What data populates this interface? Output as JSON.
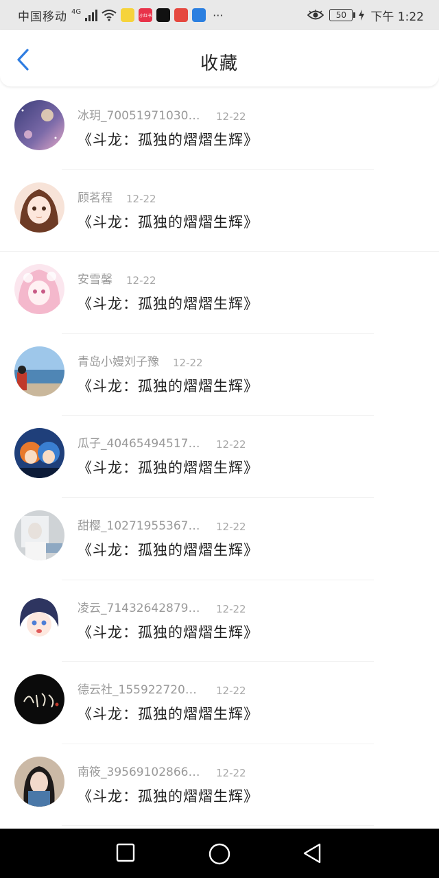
{
  "status_bar": {
    "carrier": "中国移动",
    "network": "4G",
    "more": "···",
    "battery": "50",
    "time": "下午 1:22",
    "app_icons": [
      {
        "name": "app-yellow-icon",
        "color": "#f6d33b",
        "text": ""
      },
      {
        "name": "app-xiaohongshu-icon",
        "color": "#e8334a",
        "text": "小红书"
      },
      {
        "name": "app-douyin-icon",
        "color": "#111111",
        "text": ""
      },
      {
        "name": "app-pinduoduo-icon",
        "color": "#e5483f",
        "text": ""
      },
      {
        "name": "app-blue-icon",
        "color": "#2b7fe0",
        "text": ""
      }
    ]
  },
  "nav": {
    "title": "收藏",
    "back_icon": "chevron-left-icon",
    "accent": "#2f7de1"
  },
  "list": {
    "items": [
      {
        "name": "冰玥_700519710308…",
        "date": "12-22",
        "title": "《斗龙：孤独的熠熠生辉》",
        "avatar": "night-sky"
      },
      {
        "name": "顾茗程",
        "date": "12-22",
        "title": "《斗龙：孤独的熠熠生辉》",
        "avatar": "anime-girl-brown"
      },
      {
        "name": "安雪馨",
        "date": "12-22",
        "title": "《斗龙：孤独的熠熠生辉》",
        "avatar": "anime-girl-pink"
      },
      {
        "name": "青岛小嫚刘子豫",
        "date": "12-22",
        "title": "《斗龙：孤独的熠熠生辉》",
        "avatar": "beach-photo"
      },
      {
        "name": "瓜子_404654945175…",
        "date": "12-22",
        "title": "《斗龙：孤独的熠熠生辉》",
        "avatar": "anime-warriors"
      },
      {
        "name": "甜樱_102719553670…",
        "date": "12-22",
        "title": "《斗龙：孤独的熠熠生辉》",
        "avatar": "grey-photo"
      },
      {
        "name": "凌云_714326428795…",
        "date": "12-22",
        "title": "《斗龙：孤独的熠熠生辉》",
        "avatar": "anime-boy"
      },
      {
        "name": "德云社_1559227203…",
        "date": "12-22",
        "title": "《斗龙：孤独的熠熠生辉》",
        "avatar": "calligraphy-logo"
      },
      {
        "name": "南筱_395691028666…",
        "date": "12-22",
        "title": "《斗龙：孤独的熠熠生辉》",
        "avatar": "girl-photo"
      }
    ]
  },
  "system_nav": {
    "recents": "square-icon",
    "home": "circle-icon",
    "back": "triangle-back-icon"
  }
}
